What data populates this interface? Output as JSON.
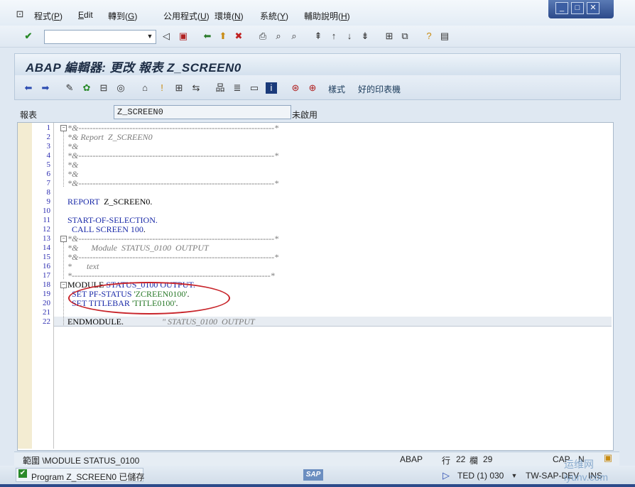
{
  "menubar": {
    "items": [
      {
        "label": "程式(",
        "hot": "P",
        "tail": ")"
      },
      {
        "label": "",
        "hot": "E",
        "tail": "dit"
      },
      {
        "label": "轉到(",
        "hot": "G",
        "tail": ")"
      },
      {
        "label": "公用程式(",
        "hot": "U",
        "tail": ")"
      },
      {
        "label": "環境(",
        "hot": "N",
        "tail": ")"
      },
      {
        "label": "系統(",
        "hot": "Y",
        "tail": ")"
      },
      {
        "label": "輔助說明(",
        "hot": "H",
        "tail": ")"
      }
    ]
  },
  "window_controls": {
    "minimize": "_",
    "maximize": "□",
    "close": "✕"
  },
  "command_field": {
    "value": ""
  },
  "title": "ABAP 編輯器: 更改 報表 Z_SCREEN0",
  "app_toolbar": {
    "style_label": "樣式",
    "pretty_printer_label": "好的印表機"
  },
  "report": {
    "label": "報表",
    "value": "Z_SCREEN0",
    "status": "未啟用"
  },
  "editor": {
    "line_numbers": [
      "1",
      "2",
      "3",
      "4",
      "5",
      "6",
      "7",
      "8",
      "9",
      "10",
      "11",
      "12",
      "13",
      "14",
      "15",
      "16",
      "17",
      "18",
      "19",
      "20",
      "21",
      "22"
    ],
    "lines": [
      {
        "segments": [
          {
            "t": "*&---------------------------------------------------------------------*",
            "c": "cmt"
          }
        ]
      },
      {
        "segments": [
          {
            "t": "*& Report  Z_SCREEN0",
            "c": "cmt"
          }
        ]
      },
      {
        "segments": [
          {
            "t": "*&",
            "c": "cmt"
          }
        ]
      },
      {
        "segments": [
          {
            "t": "*&---------------------------------------------------------------------*",
            "c": "cmt"
          }
        ]
      },
      {
        "segments": [
          {
            "t": "*&",
            "c": "cmt"
          }
        ]
      },
      {
        "segments": [
          {
            "t": "*&",
            "c": "cmt"
          }
        ]
      },
      {
        "segments": [
          {
            "t": "*&---------------------------------------------------------------------*",
            "c": "cmt"
          }
        ]
      },
      {
        "segments": []
      },
      {
        "segments": [
          {
            "t": "REPORT",
            "c": "kw"
          },
          {
            "t": "  Z_SCREEN0.",
            "c": "blk"
          }
        ]
      },
      {
        "segments": []
      },
      {
        "segments": [
          {
            "t": "START-OF-SELECTION.",
            "c": "kw"
          }
        ]
      },
      {
        "segments": [
          {
            "t": "  CALL SCREEN ",
            "c": "kw"
          },
          {
            "t": "100",
            "c": "num"
          },
          {
            "t": ".",
            "c": "blk"
          }
        ]
      },
      {
        "segments": [
          {
            "t": "*&---------------------------------------------------------------------*",
            "c": "cmt"
          }
        ]
      },
      {
        "segments": [
          {
            "t": "*&      Module  STATUS_0100  OUTPUT",
            "c": "cmt"
          }
        ]
      },
      {
        "segments": [
          {
            "t": "*&---------------------------------------------------------------------*",
            "c": "cmt"
          }
        ]
      },
      {
        "segments": [
          {
            "t": "*       text",
            "c": "cmt"
          }
        ]
      },
      {
        "segments": [
          {
            "t": "*----------------------------------------------------------------------*",
            "c": "cmt"
          }
        ]
      },
      {
        "segments": [
          {
            "t": "MODULE",
            "c": "blk"
          },
          {
            "t": " STATUS_0100 OUTPUT.",
            "c": "kw"
          }
        ]
      },
      {
        "segments": [
          {
            "t": "  SET PF-STATUS ",
            "c": "kw"
          },
          {
            "t": "'ZCREEN0100'",
            "c": "str"
          },
          {
            "t": ".",
            "c": "blk"
          }
        ]
      },
      {
        "segments": [
          {
            "t": "  SET TITLEBAR ",
            "c": "kw"
          },
          {
            "t": "'TITLE0100'",
            "c": "str"
          },
          {
            "t": ".",
            "c": "blk"
          }
        ]
      },
      {
        "segments": []
      },
      {
        "segments": [
          {
            "t": "ENDMODULE",
            "c": "blk"
          },
          {
            "t": ".                  ",
            "c": "blk"
          },
          {
            "t": "\" STATUS_0100  OUTPUT",
            "c": "cmt"
          }
        ]
      }
    ]
  },
  "infobar": {
    "scope": "範圍 \\MODULE STATUS_0100",
    "language": "ABAP",
    "row_label": "行",
    "row": "22",
    "col_label": "欄",
    "col": "29",
    "caps": "CAP",
    "num": "N"
  },
  "statusbar": {
    "message": "Program Z_SCREEN0 已儲存",
    "logo": "SAP",
    "session": "TED (1) 030",
    "server": "TW-SAP-DEV",
    "mode": "INS"
  },
  "watermark": "运维网 iyunv.com"
}
